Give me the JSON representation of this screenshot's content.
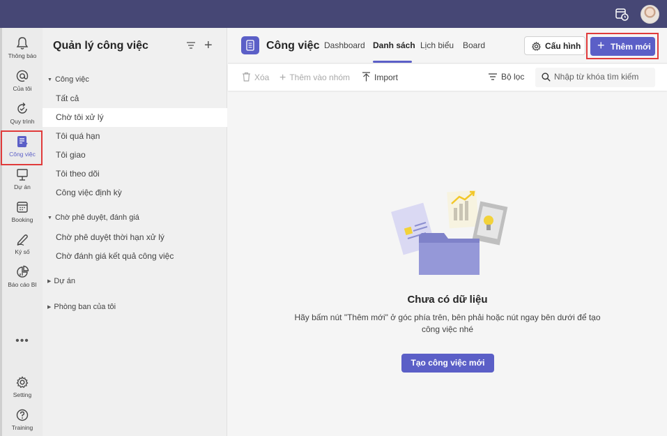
{
  "rail": {
    "items": [
      {
        "label": "Thông báo",
        "icon": "bell-icon"
      },
      {
        "label": "Của tôi",
        "icon": "at-icon"
      },
      {
        "label": "Quy trình",
        "icon": "refresh-icon"
      },
      {
        "label": "Công việc",
        "icon": "task-list-icon"
      },
      {
        "label": "Dự án",
        "icon": "presentation-icon"
      },
      {
        "label": "Booking",
        "icon": "calendar-icon"
      },
      {
        "label": "Ký số",
        "icon": "signature-icon"
      },
      {
        "label": "Báo cáo BI",
        "icon": "pie-chart-icon"
      },
      {
        "label": "Setting",
        "icon": "gear-icon"
      },
      {
        "label": "Training",
        "icon": "help-icon"
      }
    ],
    "more": "•••"
  },
  "sidebar": {
    "title": "Quản lý công việc",
    "groups": [
      {
        "label": "Công việc",
        "items": [
          "Tất cả",
          "Chờ tôi xử lý",
          "Tôi quá hạn",
          "Tôi giao",
          "Tôi theo dõi",
          "Công việc định kỳ"
        ]
      },
      {
        "label": "Chờ phê duyệt, đánh giá",
        "items": [
          "Chờ phê duyệt thời hạn xử lý",
          "Chờ đánh giá kết quả công việc"
        ]
      },
      {
        "label": "Dự án",
        "items": []
      },
      {
        "label": "Phòng ban của tôi",
        "items": []
      }
    ]
  },
  "header": {
    "title": "Công việc",
    "tabs": [
      "Dashboard",
      "Danh sách",
      "Lịch biểu",
      "Board"
    ],
    "config_label": "Cấu hình",
    "add_label": "Thêm mới"
  },
  "toolbar": {
    "delete_label": "Xóa",
    "add_group_label": "Thêm vào nhóm",
    "import_label": "Import",
    "filter_label": "Bộ lọc",
    "search_placeholder": "Nhập từ khóa tìm kiếm"
  },
  "empty": {
    "title": "Chưa có dữ liệu",
    "description": "Hãy bấm nút \"Thêm mới\" ở góc phía trên, bên phải hoặc nút ngay bên dưới để tạo công việc nhé",
    "button_label": "Tạo công việc mới"
  },
  "colors": {
    "brand": "#5b5fc7",
    "topbar": "#464775",
    "highlight": "#e03b3b"
  }
}
